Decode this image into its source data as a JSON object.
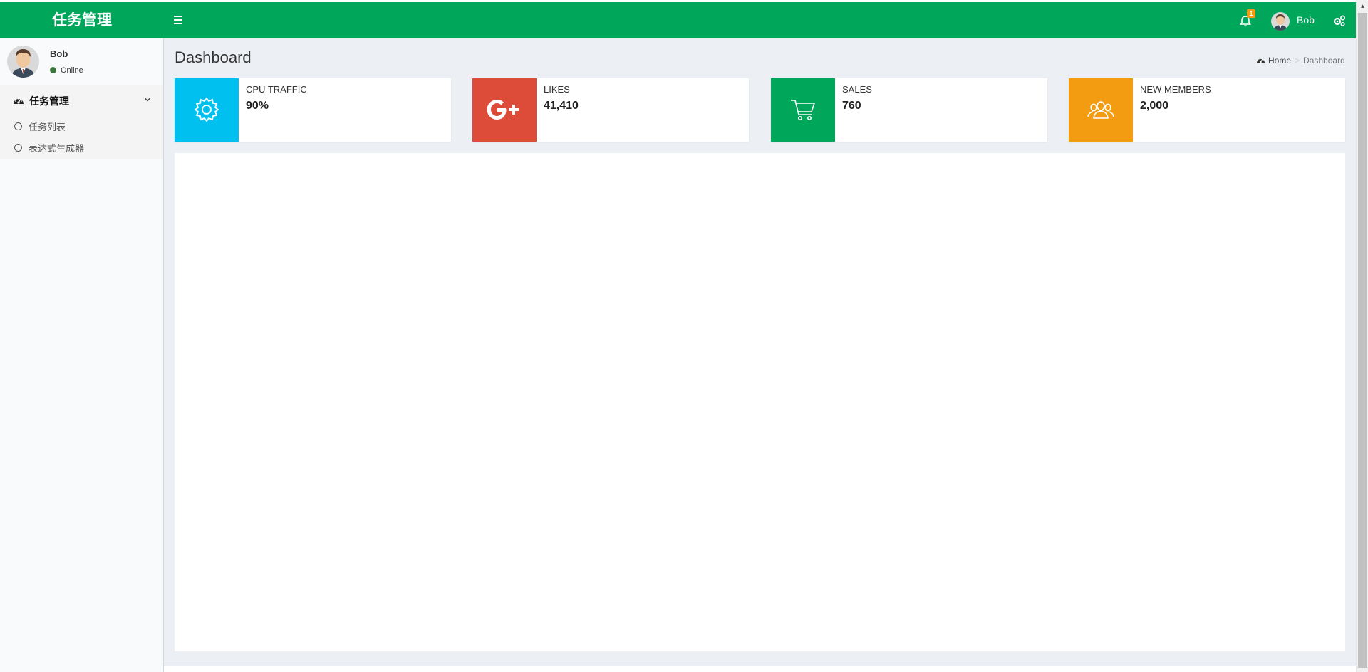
{
  "header": {
    "logo": "任务管理",
    "notification_count": "1",
    "user_name": "Bob",
    "brand_color": "#00a65a"
  },
  "sidebar": {
    "user": {
      "name": "Bob",
      "status": "Online"
    },
    "menu": {
      "label": "任务管理",
      "items": [
        {
          "label": "任务列表"
        },
        {
          "label": "表达式生成器"
        }
      ]
    }
  },
  "content": {
    "title": "Dashboard",
    "breadcrumb": {
      "home": "Home",
      "current": "Dashboard"
    }
  },
  "info_boxes": [
    {
      "label": "CPU TRAFFIC",
      "value": "90%",
      "icon": "gear-icon",
      "color": "#00c0ef"
    },
    {
      "label": "LIKES",
      "value": "41,410",
      "icon": "google-plus-icon",
      "color": "#dd4b39"
    },
    {
      "label": "SALES",
      "value": "760",
      "icon": "cart-icon",
      "color": "#00a65a"
    },
    {
      "label": "NEW MEMBERS",
      "value": "2,000",
      "icon": "users-icon",
      "color": "#f39c12"
    }
  ]
}
